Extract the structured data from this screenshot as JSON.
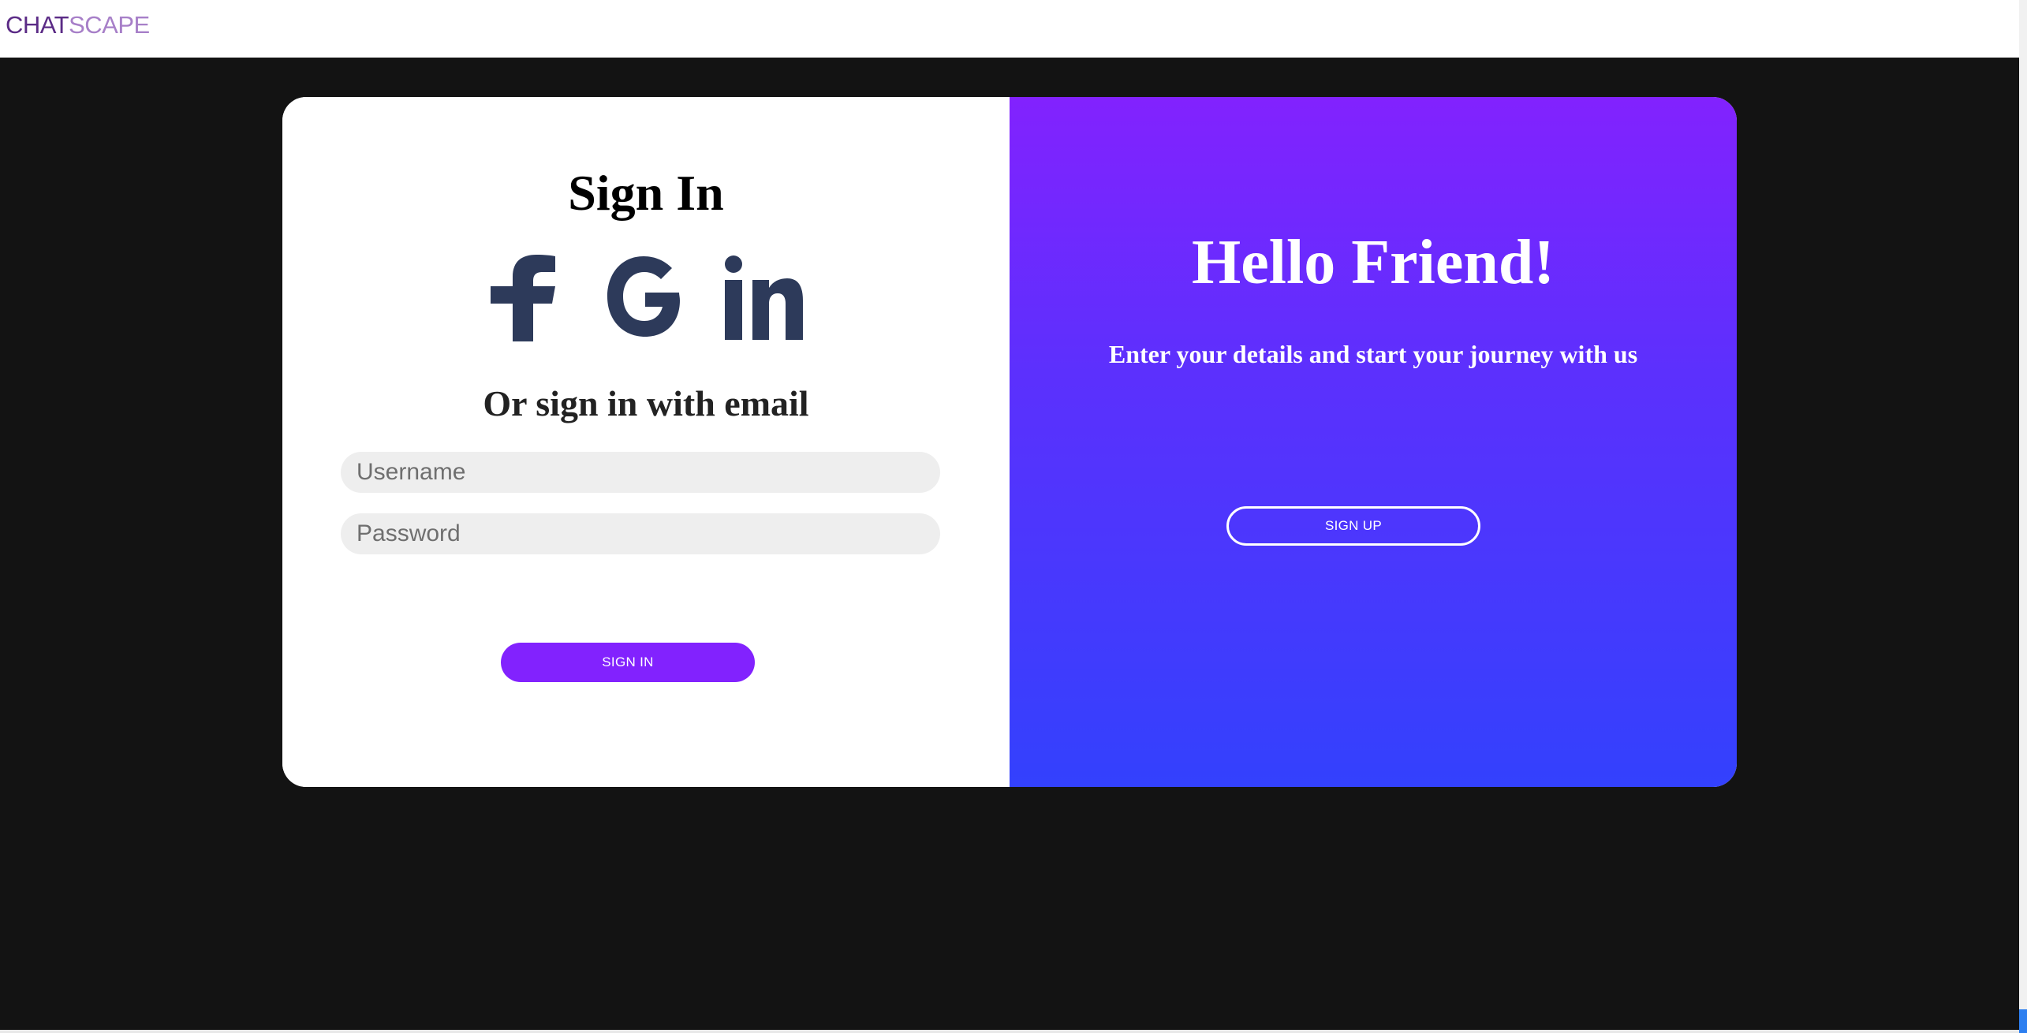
{
  "header": {
    "logo_part1": "CHAT",
    "logo_part2": "SCAPE"
  },
  "signin": {
    "title": "Sign In",
    "socials": [
      {
        "icon": "facebook-icon"
      },
      {
        "icon": "google-icon"
      },
      {
        "icon": "linkedin-icon"
      }
    ],
    "alt_title": "Or sign in with email",
    "username_placeholder": "Username",
    "password_placeholder": "Password",
    "button_label": "SIGN IN"
  },
  "signup": {
    "title": "Hello Friend!",
    "subtitle": "Enter your details and start your journey with us",
    "button_label": "SIGN UP"
  },
  "colors": {
    "accent": "#8222fe",
    "gradient_top": "#8222fe",
    "gradient_bottom": "#3341fd",
    "social_icon": "#2d3a5a",
    "page_background": "#131313"
  }
}
